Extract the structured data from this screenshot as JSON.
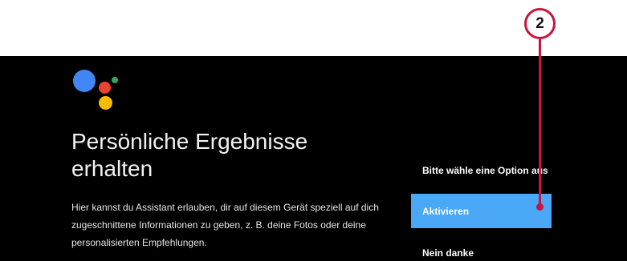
{
  "assistant_logo": {
    "icon": "google-assistant-logo",
    "colors": {
      "blue": "#4285F4",
      "red": "#EA4335",
      "yellow": "#FBBC05",
      "green": "#34A853"
    }
  },
  "screen": {
    "title": "Persönliche Ergebnisse erhalten",
    "description": "Hier kannst du Assistant erlauben, dir auf diesem Gerät speziell auf dich zugeschnittene Informationen zu geben, z. B. deine Fotos oder deine personalisierten Empfehlungen."
  },
  "options": {
    "heading": "Bitte wähle eine Option aus",
    "activate_label": "Aktivieren",
    "decline_label": "Nein danke",
    "accent_color": "#4AA8F6"
  },
  "callout": {
    "number": "2",
    "color": "#C8143C"
  }
}
